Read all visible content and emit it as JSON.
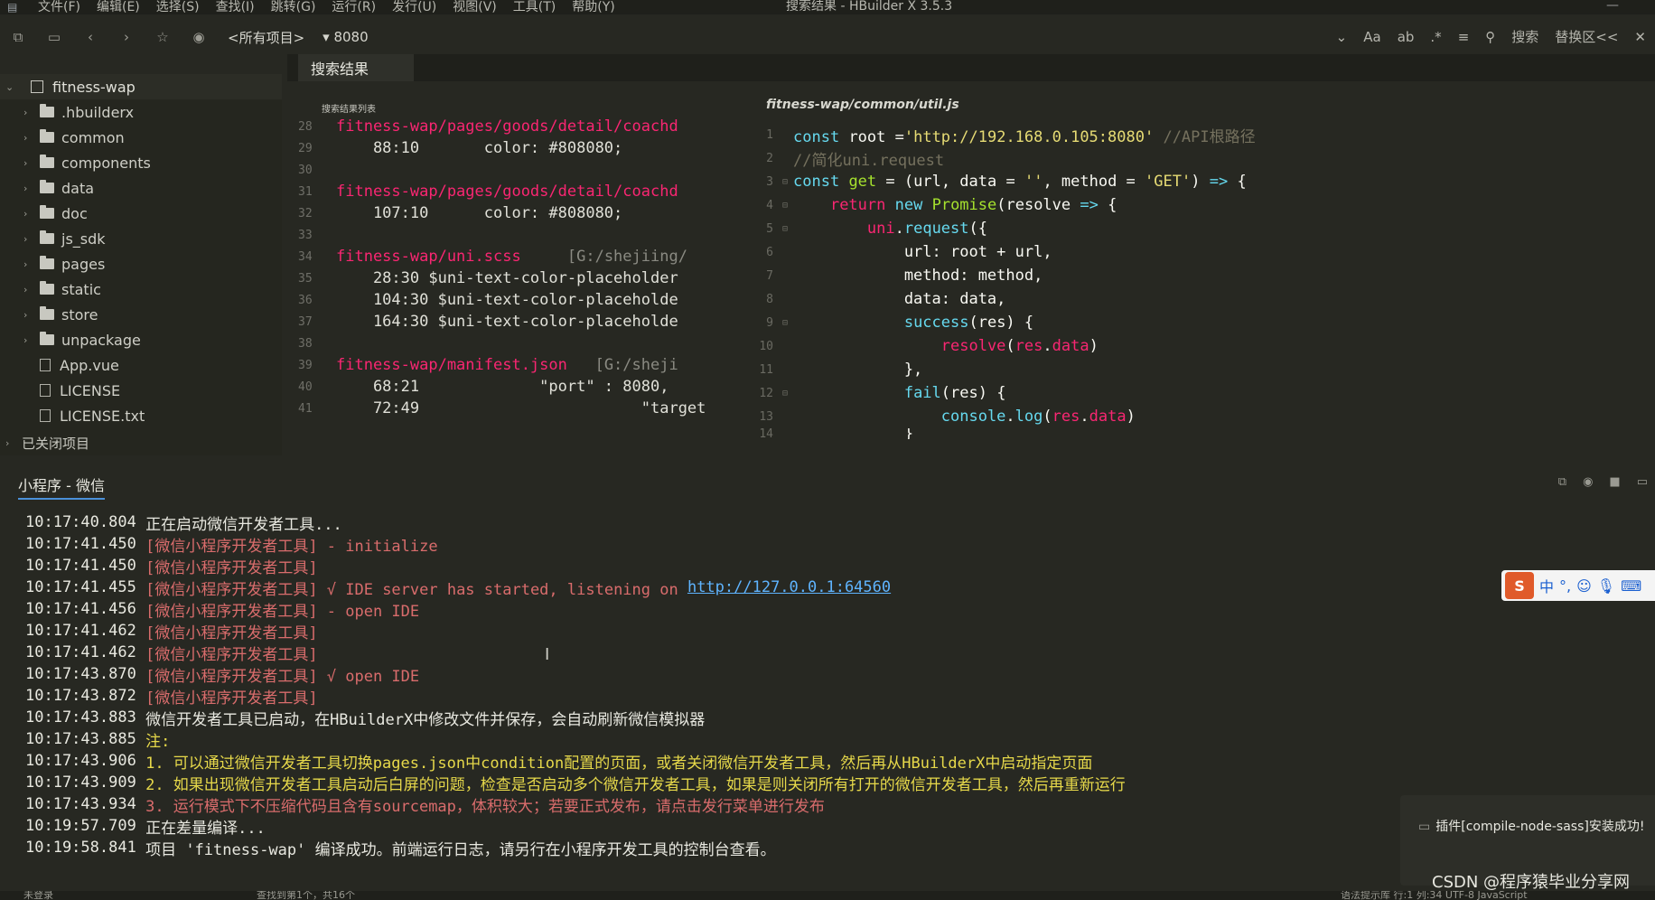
{
  "window": {
    "title": "搜索结果 - HBuilder X 3.5.3",
    "menu": [
      "文件(F)",
      "编辑(E)",
      "选择(S)",
      "查找(I)",
      "跳转(G)",
      "运行(R)",
      "发行(U)",
      "视图(V)",
      "工具(T)",
      "帮助(Y)"
    ]
  },
  "toolbar": {
    "project_selector": "<所有项目>",
    "search_text": "8080",
    "right_items": [
      "Aa",
      "搜索",
      "替换区<<"
    ]
  },
  "sidebar": {
    "root": "fitness-wap",
    "items": [
      {
        "label": ".hbuilderx",
        "type": "folder"
      },
      {
        "label": "common",
        "type": "folder"
      },
      {
        "label": "components",
        "type": "folder"
      },
      {
        "label": "data",
        "type": "folder"
      },
      {
        "label": "doc",
        "type": "folder"
      },
      {
        "label": "js_sdk",
        "type": "folder"
      },
      {
        "label": "pages",
        "type": "folder"
      },
      {
        "label": "static",
        "type": "folder"
      },
      {
        "label": "store",
        "type": "folder"
      },
      {
        "label": "unpackage",
        "type": "folder"
      },
      {
        "label": "App.vue",
        "type": "file"
      },
      {
        "label": "LICENSE",
        "type": "file"
      },
      {
        "label": "LICENSE.txt",
        "type": "file"
      }
    ],
    "closed_projects": "已关闭项目"
  },
  "search_panel": {
    "tab": "搜索结果",
    "header": "搜索结果列表",
    "lines": [
      {
        "n": "28",
        "text": "fitness-wap/pages/goods/detail/coachd",
        "kind": "path"
      },
      {
        "n": "29",
        "text": "    88:10       color: #808080;",
        "kind": "code"
      },
      {
        "n": "30",
        "text": "",
        "kind": "code"
      },
      {
        "n": "31",
        "text": "fitness-wap/pages/goods/detail/coachd",
        "kind": "path"
      },
      {
        "n": "32",
        "text": "    107:10      color: #808080;",
        "kind": "code"
      },
      {
        "n": "33",
        "text": "",
        "kind": "code"
      },
      {
        "n": "34",
        "text": "fitness-wap/uni.scss",
        "kind": "path",
        "extra": "     [G:/shejiing/"
      },
      {
        "n": "35",
        "text": "    28:30 $uni-text-color-placeholder",
        "kind": "code"
      },
      {
        "n": "36",
        "text": "    104:30 $uni-text-color-placeholde",
        "kind": "code"
      },
      {
        "n": "37",
        "text": "    164:30 $uni-text-color-placeholde",
        "kind": "code"
      },
      {
        "n": "38",
        "text": "",
        "kind": "code"
      },
      {
        "n": "39",
        "text": "fitness-wap/manifest.json",
        "kind": "path",
        "extra": "   [G:/sheji"
      },
      {
        "n": "40",
        "text": "    68:21             \"port\" : 8080,",
        "kind": "code"
      },
      {
        "n": "41",
        "text": "    72:49                        \"target",
        "kind": "code"
      }
    ]
  },
  "editor": {
    "file_path": "fitness-wap/common/util.js",
    "line_numbers": [
      "1",
      "2",
      "3",
      "4",
      "5",
      "6",
      "7",
      "8",
      "9",
      "10",
      "11",
      "12",
      "13",
      "14"
    ]
  },
  "console": {
    "tab": "小程序 - 微信",
    "lines": [
      {
        "ts": "10:17:40.804",
        "msg": "正在启动微信开发者工具...",
        "color": "white"
      },
      {
        "ts": "10:17:41.450",
        "msg": "[微信小程序开发者工具] - initialize",
        "color": "red"
      },
      {
        "ts": "10:17:41.450",
        "msg": "[微信小程序开发者工具]",
        "color": "red"
      },
      {
        "ts": "10:17:41.455",
        "msg": "[微信小程序开发者工具] √ IDE server has started, listening on ",
        "color": "red",
        "link": "http://127.0.0.1:64560"
      },
      {
        "ts": "10:17:41.456",
        "msg": "[微信小程序开发者工具] - open IDE",
        "color": "red"
      },
      {
        "ts": "10:17:41.462",
        "msg": "[微信小程序开发者工具]",
        "color": "red"
      },
      {
        "ts": "10:17:41.462",
        "msg": "[微信小程序开发者工具]",
        "color": "red"
      },
      {
        "ts": "10:17:43.870",
        "msg": "[微信小程序开发者工具] √ open IDE",
        "color": "red"
      },
      {
        "ts": "10:17:43.872",
        "msg": "[微信小程序开发者工具]",
        "color": "red"
      },
      {
        "ts": "10:17:43.883",
        "msg": "微信开发者工具已启动，在HBuilderX中修改文件并保存，会自动刷新微信模拟器",
        "color": "white"
      },
      {
        "ts": "10:17:43.885",
        "msg": "注:",
        "color": "yellow"
      },
      {
        "ts": "10:17:43.906",
        "msg": "1. 可以通过微信开发者工具切换pages.json中condition配置的页面，或者关闭微信开发者工具，然后再从HBuilderX中启动指定页面",
        "color": "yellow"
      },
      {
        "ts": "10:17:43.909",
        "msg": "2. 如果出现微信开发者工具启动后白屏的问题，检查是否启动多个微信开发者工具，如果是则关闭所有打开的微信开发者工具，然后再重新运行",
        "color": "yellow"
      },
      {
        "ts": "10:17:43.934",
        "msg": "3. 运行模式下不压缩代码且含有sourcemap，体积较大；若要正式发布，请点击发行菜单进行发布",
        "color": "red"
      },
      {
        "ts": "10:19:57.709",
        "msg": "正在差量编译...",
        "color": "white"
      },
      {
        "ts": "10:19:58.841",
        "msg": "项目 'fitness-wap' 编译成功。前端运行日志，请另行在小程序开发工具的控制台查看。",
        "color": "white"
      }
    ]
  },
  "ime": {
    "label1": "中",
    "label2": "°,"
  },
  "toast": "插件[compile-node-sass]安装成功!",
  "watermark": "CSDN @程序猿毕业分享网",
  "statusbar": {
    "left": "未登录",
    "search_info": "查找到第1个，共16个",
    "right": "语法提示库    行:1  列:34    UTF-8    JavaScript"
  },
  "colors": {
    "background": "#272822",
    "keyword": "#66d9ef",
    "string": "#e6db74",
    "tag": "#f92672",
    "function": "#a6e22e"
  }
}
